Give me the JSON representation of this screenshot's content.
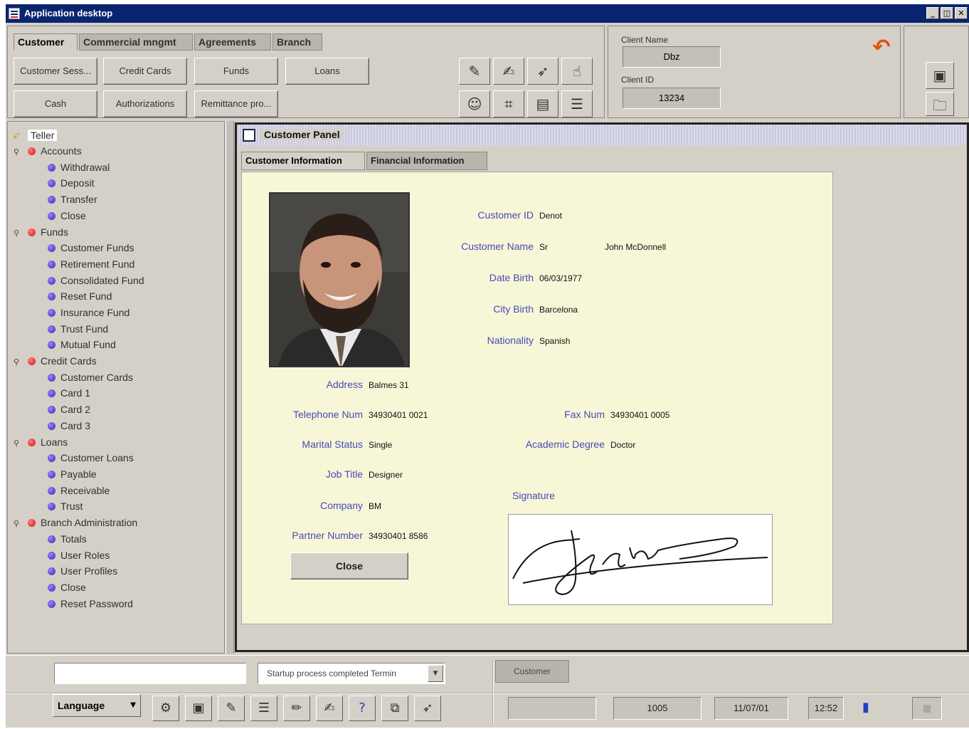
{
  "window": {
    "title": "Application desktop",
    "controls": [
      "_",
      "◫",
      "✕"
    ]
  },
  "top_tabs": [
    "Customer",
    "Commercial mngmt",
    "Agreements",
    "Branch"
  ],
  "top_buttons_row1": [
    "Customer Sess...",
    "Credit Cards",
    "Funds",
    "Loans"
  ],
  "top_buttons_row2": [
    "Cash",
    "Authorizations",
    "Remittance pro..."
  ],
  "client": {
    "name_label": "Client Name",
    "name_value": "Dbz",
    "id_label": "Client ID",
    "id_value": "13234"
  },
  "tree": {
    "root": "Teller",
    "groups": [
      {
        "label": "Accounts",
        "children": [
          "Withdrawal",
          "Deposit",
          "Transfer",
          "Close"
        ]
      },
      {
        "label": "Funds",
        "children": [
          "Customer Funds",
          "Retirement Fund",
          "Consolidated Fund",
          "Reset Fund",
          "Insurance Fund",
          "Trust Fund",
          "Mutual Fund"
        ]
      },
      {
        "label": "Credit Cards",
        "children": [
          "Customer Cards",
          "Card 1",
          "Card 2",
          "Card 3"
        ]
      },
      {
        "label": "Loans",
        "children": [
          "Customer Loans",
          "Payable",
          "Receivable",
          "Trust"
        ]
      },
      {
        "label": "Branch Administration",
        "children": [
          "Totals",
          "User Roles",
          "User Profiles",
          "Close",
          "Reset Password"
        ]
      }
    ]
  },
  "panel": {
    "title": "Customer Panel",
    "tabs": [
      "Customer Information",
      "Financial Information"
    ],
    "fields": {
      "customer_id": {
        "label": "Customer ID",
        "value": "Denot"
      },
      "customer_name": {
        "label": "Customer Name",
        "prefix": "Sr",
        "value": "John McDonnell"
      },
      "date_birth": {
        "label": "Date Birth",
        "value": "06/03/1977"
      },
      "city_birth": {
        "label": "City Birth",
        "value": "Barcelona"
      },
      "nationality": {
        "label": "Nationality",
        "value": "Spanish"
      },
      "address": {
        "label": "Address",
        "value": "Balmes 31"
      },
      "telephone": {
        "label": "Telephone Num",
        "value": "34930401 0021"
      },
      "fax": {
        "label": "Fax Num",
        "value": "34930401 0005"
      },
      "marital": {
        "label": "Marital Status",
        "value": "Single"
      },
      "degree": {
        "label": "Academic Degree",
        "value": "Doctor"
      },
      "job": {
        "label": "Job Title",
        "value": "Designer"
      },
      "company": {
        "label": "Company",
        "value": "BM"
      },
      "partner": {
        "label": "Partner Number",
        "value": "34930401 8586"
      },
      "signature": {
        "label": "Signature"
      }
    },
    "close_label": "Close"
  },
  "status": {
    "message": "Startup process completed Termin",
    "chip": "Customer",
    "language": "Language",
    "code": "1005",
    "date": "11/07/01",
    "time": "12:52"
  }
}
